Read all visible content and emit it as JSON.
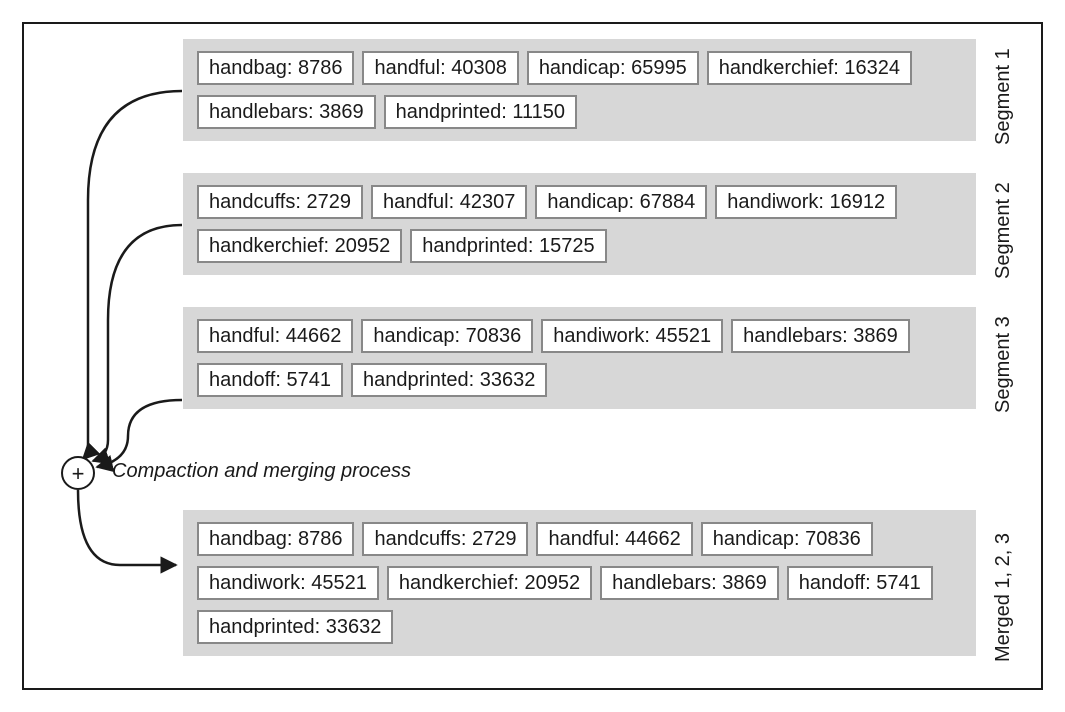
{
  "segments": [
    {
      "id": "seg1",
      "label": "Segment 1",
      "entries": [
        [
          "handbag: 8786",
          "handful: 40308",
          "handicap: 65995",
          "handkerchief: 16324"
        ],
        [
          "handlebars: 3869",
          "handprinted: 11150"
        ]
      ]
    },
    {
      "id": "seg2",
      "label": "Segment 2",
      "entries": [
        [
          "handcuffs: 2729",
          "handful: 42307",
          "handicap: 67884",
          "handiwork: 16912"
        ],
        [
          "handkerchief: 20952",
          "handprinted: 15725"
        ]
      ]
    },
    {
      "id": "seg3",
      "label": "Segment 3",
      "entries": [
        [
          "handful: 44662",
          "handicap: 70836",
          "handiwork: 45521",
          "handlebars: 3869"
        ],
        [
          "handoff: 5741",
          "handprinted: 33632"
        ]
      ]
    },
    {
      "id": "merged",
      "label": "Merged 1, 2, 3",
      "entries": [
        [
          "handbag: 8786",
          "handcuffs: 2729",
          "handful: 44662",
          "handicap: 70836"
        ],
        [
          "handiwork: 45521",
          "handkerchief: 20952",
          "handlebars: 3869",
          "handoff: 5741"
        ],
        [
          "handprinted: 33632"
        ]
      ]
    }
  ],
  "process_label": "Compaction and merging process",
  "plus_glyph": "+"
}
